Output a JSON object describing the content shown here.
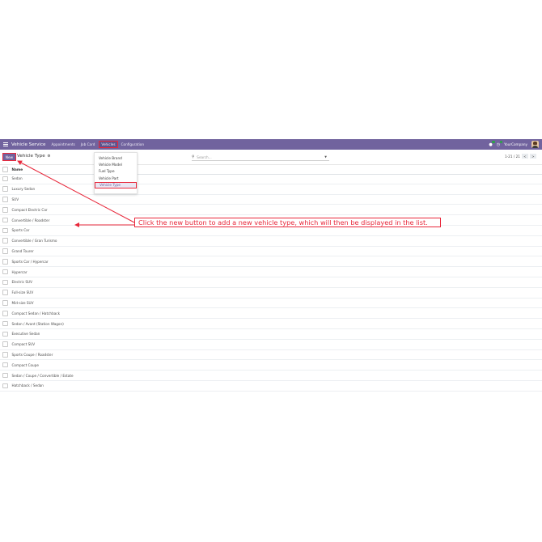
{
  "navbar": {
    "brand": "Vehicle Service",
    "menu": [
      "Appointments",
      "Job Card",
      "Vehicles",
      "Configuration"
    ],
    "active_menu": "Vehicles",
    "company": "YourCompany",
    "icons": [
      "apps-grid-icon",
      "chat-icon",
      "activity-clock-icon",
      "user-avatar"
    ]
  },
  "control_panel": {
    "new_label": "New",
    "title": "Vehicle Type",
    "search_placeholder": "Search...",
    "pager": "1-21 / 21",
    "prev_label": "<",
    "next_label": ">"
  },
  "dropdown": {
    "items": [
      "Vehicle Brand",
      "Vehicle Model",
      "Fuel Type",
      "Vehicle Part",
      "Vehicle Type"
    ],
    "highlighted": "Vehicle Type"
  },
  "list": {
    "header": "Name",
    "rows": [
      "Sedan",
      "Luxury Sedan",
      "SUV",
      "Compact Electric Car",
      "Convertible / Roadster",
      "Sports Car",
      "Convertible / Gran Turismo",
      "Grand Tourer",
      "Sports Car / Hypercar",
      "Hypercar",
      "Electric SUV",
      "Full-size SUV",
      "Mid-size SUV",
      "Compact Sedan / Hatchback",
      "Sedan / Avant (Station Wagon)",
      "Executive Sedan",
      "Compact SUV",
      "Sports Coupe / Roadster",
      "Compact Coupe",
      "Sedan / Coupe / Convertible / Estate",
      "Hatchback / Sedan"
    ]
  },
  "annotation": {
    "text": "Click the new button to add a new vehicle type, which will then be displayed in the list.",
    "color": "#e8283b"
  },
  "colors": {
    "navbar": "#71639e",
    "highlight": "#e8283b"
  }
}
